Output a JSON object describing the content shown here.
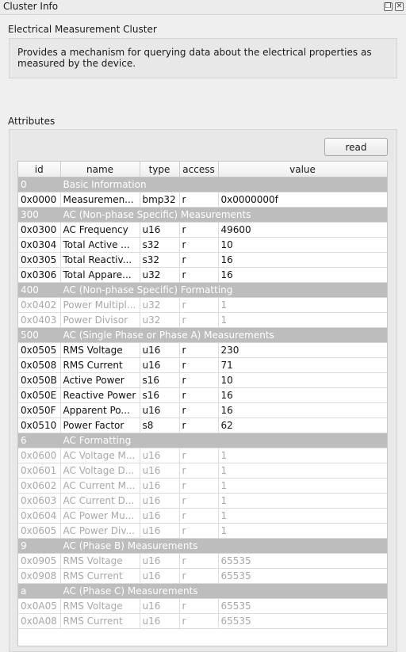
{
  "window": {
    "title": "Cluster Info",
    "float_icon": "float-icon",
    "close_icon": "close-icon"
  },
  "cluster": {
    "name": "Electrical Measurement Cluster",
    "description": "Provides a mechanism for querying data about the electrical properties as measured by the device."
  },
  "attributes": {
    "label": "Attributes",
    "read_button": "read",
    "columns": [
      "id",
      "name",
      "type",
      "access",
      "value"
    ],
    "rows": [
      {
        "group": true,
        "id": "0",
        "name": "Basic Information"
      },
      {
        "id": "0x0000",
        "name": "Measuremen...",
        "type": "bmp32",
        "access": "r",
        "value": "0x0000000f",
        "enabled": true
      },
      {
        "group": true,
        "id": "300",
        "name": "AC (Non-phase Specific) Measurements"
      },
      {
        "id": "0x0300",
        "name": "AC Frequency",
        "type": "u16",
        "access": "r",
        "value": "49600",
        "enabled": true
      },
      {
        "id": "0x0304",
        "name": "Total Active ...",
        "type": "s32",
        "access": "r",
        "value": "10",
        "enabled": true
      },
      {
        "id": "0x0305",
        "name": "Total Reactiv...",
        "type": "s32",
        "access": "r",
        "value": "16",
        "enabled": true
      },
      {
        "id": "0x0306",
        "name": "Total Appare...",
        "type": "u32",
        "access": "r",
        "value": "16",
        "enabled": true
      },
      {
        "group": true,
        "id": "400",
        "name": "AC (Non-phase Specific) Formatting"
      },
      {
        "id": "0x0402",
        "name": "Power Multipl...",
        "type": "u32",
        "access": "r",
        "value": "1",
        "enabled": false
      },
      {
        "id": "0x0403",
        "name": "Power Divisor",
        "type": "u32",
        "access": "r",
        "value": "1",
        "enabled": false
      },
      {
        "group": true,
        "id": "500",
        "name": "AC (Single Phase or Phase A) Measurements"
      },
      {
        "id": "0x0505",
        "name": "RMS Voltage",
        "type": "u16",
        "access": "r",
        "value": "230",
        "enabled": true
      },
      {
        "id": "0x0508",
        "name": "RMS Current",
        "type": "u16",
        "access": "r",
        "value": "71",
        "enabled": true
      },
      {
        "id": "0x050B",
        "name": "Active Power",
        "type": "s16",
        "access": "r",
        "value": "10",
        "enabled": true
      },
      {
        "id": "0x050E",
        "name": "Reactive Power",
        "type": "s16",
        "access": "r",
        "value": "16",
        "enabled": true
      },
      {
        "id": "0x050F",
        "name": "Apparent Po...",
        "type": "u16",
        "access": "r",
        "value": "16",
        "enabled": true
      },
      {
        "id": "0x0510",
        "name": "Power Factor",
        "type": "s8",
        "access": "r",
        "value": "62",
        "enabled": true
      },
      {
        "group": true,
        "id": "6",
        "name": "AC Formatting"
      },
      {
        "id": "0x0600",
        "name": "AC Voltage M...",
        "type": "u16",
        "access": "r",
        "value": "1",
        "enabled": false
      },
      {
        "id": "0x0601",
        "name": "AC Voltage D...",
        "type": "u16",
        "access": "r",
        "value": "1",
        "enabled": false
      },
      {
        "id": "0x0602",
        "name": "AC Current M...",
        "type": "u16",
        "access": "r",
        "value": "1",
        "enabled": false
      },
      {
        "id": "0x0603",
        "name": "AC Current D...",
        "type": "u16",
        "access": "r",
        "value": "1",
        "enabled": false
      },
      {
        "id": "0x0604",
        "name": "AC Power Mu...",
        "type": "u16",
        "access": "r",
        "value": "1",
        "enabled": false
      },
      {
        "id": "0x0605",
        "name": "AC Power Div...",
        "type": "u16",
        "access": "r",
        "value": "1",
        "enabled": false
      },
      {
        "group": true,
        "id": "9",
        "name": "AC (Phase B) Measurements"
      },
      {
        "id": "0x0905",
        "name": "RMS Voltage",
        "type": "u16",
        "access": "r",
        "value": "65535",
        "enabled": false
      },
      {
        "id": "0x0908",
        "name": "RMS Current",
        "type": "u16",
        "access": "r",
        "value": "65535",
        "enabled": false
      },
      {
        "group": true,
        "id": "a",
        "name": "AC (Phase C) Measurements"
      },
      {
        "id": "0x0A05",
        "name": "RMS Voltage",
        "type": "u16",
        "access": "r",
        "value": "65535",
        "enabled": false
      },
      {
        "id": "0x0A08",
        "name": "RMS Current",
        "type": "u16",
        "access": "r",
        "value": "65535",
        "enabled": false
      }
    ]
  }
}
